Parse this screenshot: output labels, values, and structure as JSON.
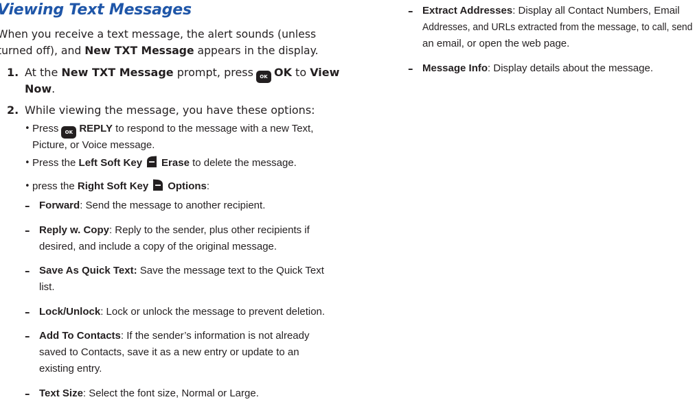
{
  "heading": "Viewing Text Messages",
  "intro": {
    "line1_a": "When you receive a text message, the alert sounds (unless",
    "line2_a": "turned off), and ",
    "line2_b": "New TXT Message",
    "line2_c": " appears in the display."
  },
  "steps": [
    {
      "num": "1.",
      "a": "At the ",
      "b": "New TXT Message",
      "c": " prompt, press",
      "key": "OK",
      "d": "OK",
      "e": " to ",
      "f": "View",
      "g": "Now",
      "h": "."
    },
    {
      "num": "2.",
      "a": "While viewing the message, you have these options:"
    }
  ],
  "bullets": [
    {
      "dot": "•",
      "pre": "Press",
      "key": "OK",
      "bold": "REPLY",
      "post": " to respond to the message with a new Text,",
      "cont": "Picture, or Voice message."
    },
    {
      "dot": "•",
      "pre": "Press the ",
      "bold1": "Left Soft Key",
      "bold2": "Erase",
      "post": " to delete the message."
    },
    {
      "dot": "•",
      "pre": "press the ",
      "bold1": "Right Soft Key",
      "bold2": "Options",
      "post": ":"
    }
  ],
  "options": [
    {
      "label": "Forward",
      "text": ": Send the message to another recipient.",
      "cont": []
    },
    {
      "label": "Reply w. Copy",
      "text": ": Reply to the sender, plus other recipients if",
      "cont": [
        "desired, and include a copy of the original message."
      ]
    },
    {
      "label": "Save As Quick Text:",
      "text": " Save the message text to the Quick Text",
      "cont": [
        "list."
      ]
    },
    {
      "label": "Lock/Unlock",
      "text": ": Lock or unlock the message to prevent deletion.",
      "cont": []
    },
    {
      "label": "Add To Contacts",
      "text": ": If the sender’s information is not already",
      "cont": [
        "saved to Contacts, save it as a new entry or update to an",
        "existing entry."
      ]
    },
    {
      "label": "Text Size",
      "text": ": Select the font size, Normal or Large.",
      "cont": []
    }
  ],
  "right_options": [
    {
      "label": "Extract Addresses",
      "text": ": Display all Contact Numbers, Email",
      "cont": [
        "Addresses, and URLs extracted from the message, to call, send",
        "an email, or open the web page."
      ]
    },
    {
      "label": "Message Info",
      "text": ": Display details about the message.",
      "cont": []
    }
  ],
  "dash": "–",
  "colors": {
    "heading": "#1f56a8",
    "text": "#231f20",
    "key_bg": "#231f20"
  },
  "icons": {
    "ok_key": "ok-key-icon",
    "left_soft_key": "left-soft-key-icon",
    "right_soft_key": "right-soft-key-icon"
  }
}
